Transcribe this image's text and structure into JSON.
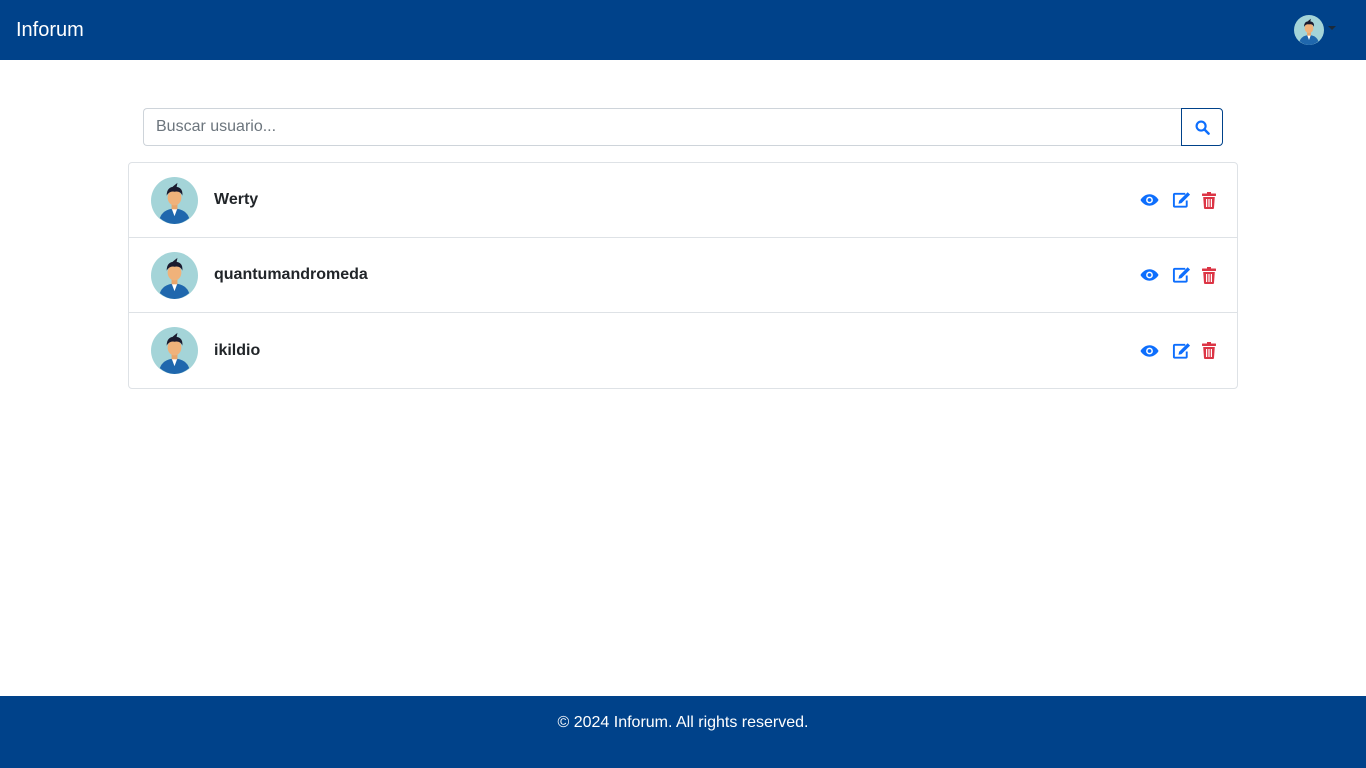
{
  "navbar": {
    "brand": "Inforum",
    "user_avatar_icon": "user-avatar-icon",
    "dropdown_icon": "caret-down-icon"
  },
  "search": {
    "placeholder": "Buscar usuario...",
    "value": "",
    "button_icon": "search-icon"
  },
  "users": [
    {
      "name": "Werty",
      "avatar": "user-avatar-icon"
    },
    {
      "name": "quantumandromeda",
      "avatar": "user-avatar-icon"
    },
    {
      "name": "ikildio",
      "avatar": "user-avatar-icon"
    }
  ],
  "actions": {
    "view_icon": "eye-icon",
    "edit_icon": "edit-icon",
    "delete_icon": "trash-icon"
  },
  "footer": {
    "text": "© 2024 Inforum. All rights reserved."
  },
  "colors": {
    "primary": "#00428a",
    "action_blue": "#0d6efd",
    "danger": "#dc3545",
    "border": "#dee2e6"
  }
}
